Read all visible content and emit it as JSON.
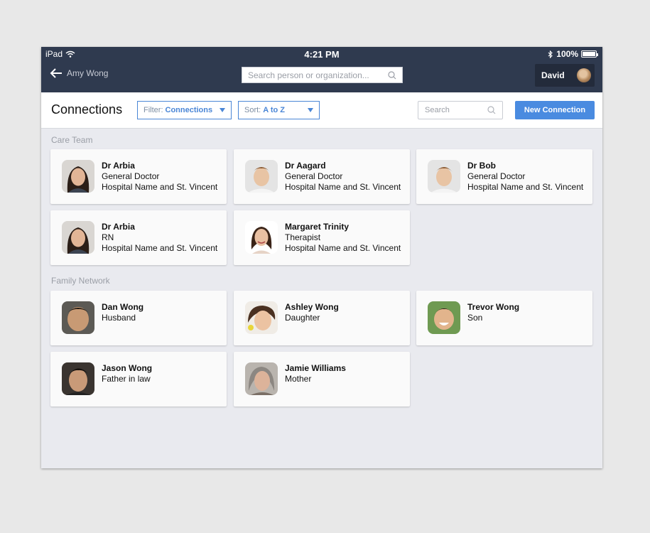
{
  "status": {
    "device": "iPad",
    "time": "4:21 PM",
    "battery": "100%"
  },
  "nav": {
    "back_label": "Amy Wong",
    "search_placeholder": "Search person or organization...",
    "user_name": "David"
  },
  "toolbar": {
    "title": "Connections",
    "filter_label": "Filter:",
    "filter_value": "Connections",
    "sort_label": "Sort:",
    "sort_value": "A to Z",
    "search_placeholder": "Search",
    "new_button": "New Connection"
  },
  "sections": [
    {
      "title": "Care Team",
      "cards": [
        {
          "name": "Dr Arbia",
          "line1": "General Doctor",
          "line2": "Hospital Name and St. Vincent"
        },
        {
          "name": "Dr Aagard",
          "line1": "General Doctor",
          "line2": "Hospital Name and St. Vincent"
        },
        {
          "name": "Dr Bob",
          "line1": "General Doctor",
          "line2": "Hospital Name and St. Vincent"
        },
        {
          "name": "Dr Arbia",
          "line1": "RN",
          "line2": "Hospital Name and St. Vincent"
        },
        {
          "name": "Margaret Trinity",
          "line1": "Therapist",
          "line2": "Hospital Name and St. Vincent"
        }
      ]
    },
    {
      "title": "Family Network",
      "cards": [
        {
          "name": "Dan Wong",
          "line1": "Husband"
        },
        {
          "name": "Ashley Wong",
          "line1": "Daughter"
        },
        {
          "name": "Trevor Wong",
          "line1": "Son"
        },
        {
          "name": "Jason Wong",
          "line1": "Father in law"
        },
        {
          "name": "Jamie Williams",
          "line1": "Mother"
        }
      ]
    }
  ],
  "colors": {
    "nav_bg": "#2f3a4f",
    "accent": "#4a8be0",
    "page_bg": "#e9eaef"
  }
}
